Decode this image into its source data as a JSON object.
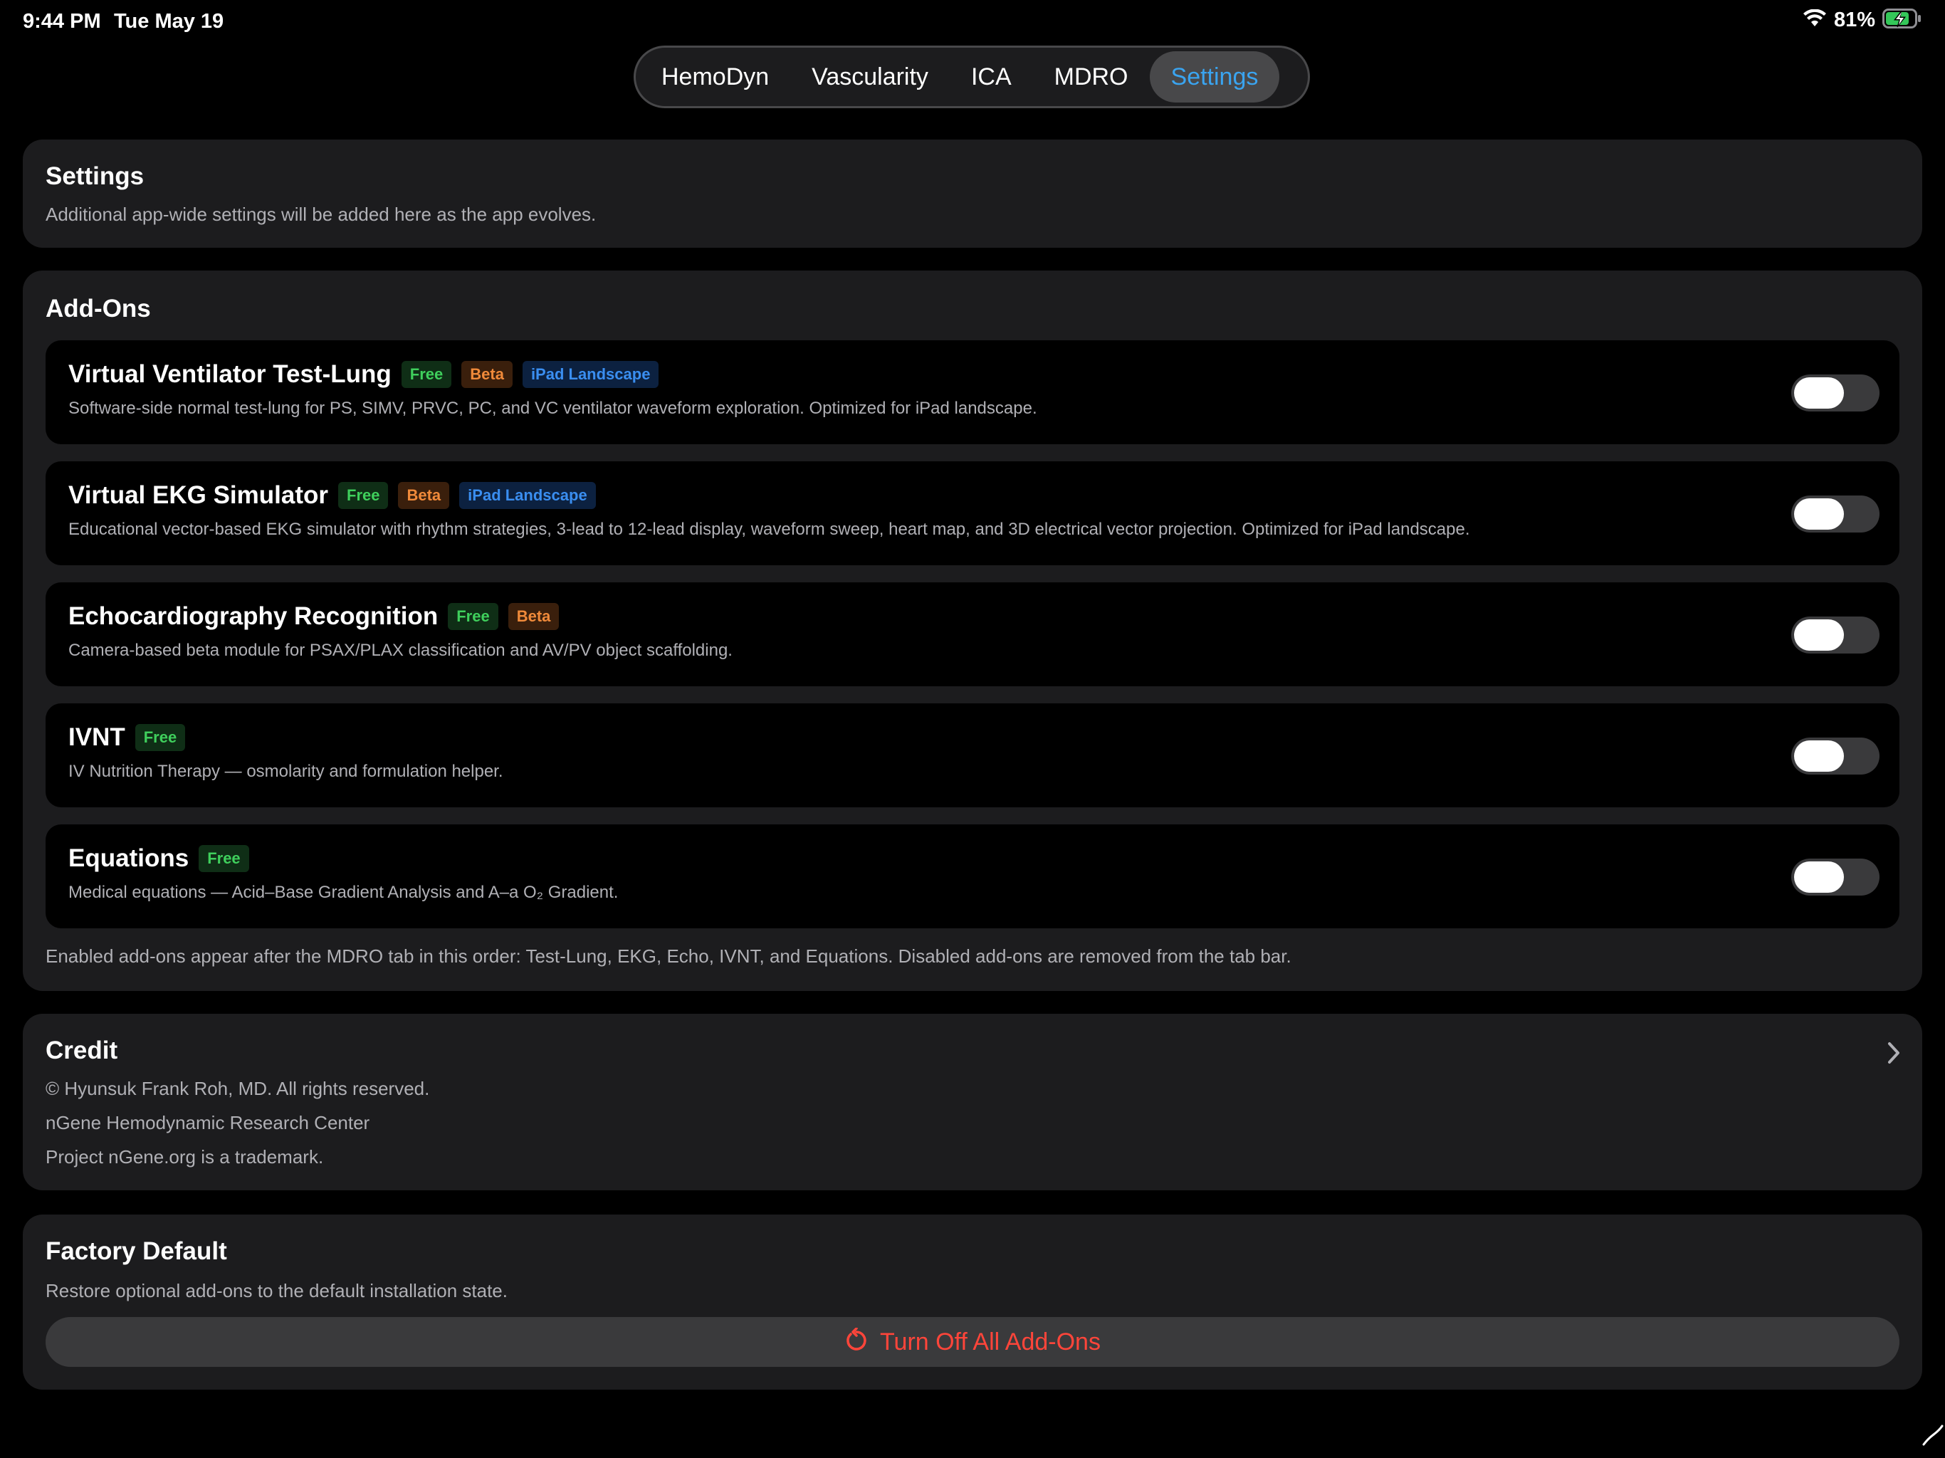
{
  "status_bar": {
    "time": "9:44 PM",
    "date": "Tue May 19",
    "battery": "81%"
  },
  "tabs": [
    {
      "label": "HemoDyn",
      "active": false
    },
    {
      "label": "Vascularity",
      "active": false
    },
    {
      "label": "ICA",
      "active": false
    },
    {
      "label": "MDRO",
      "active": false
    },
    {
      "label": "Settings",
      "active": true
    }
  ],
  "settings": {
    "title": "Settings",
    "subtitle": "Additional app-wide settings will be added here as the app evolves."
  },
  "addons": {
    "title": "Add-Ons",
    "items": [
      {
        "name": "Virtual Ventilator Test-Lung",
        "badges": [
          "Free",
          "Beta",
          "iPad Landscape"
        ],
        "description": "Software-side normal test-lung for PS, SIMV, PRVC, PC, and VC ventilator waveform exploration. Optimized for iPad landscape.",
        "enabled": false
      },
      {
        "name": "Virtual EKG Simulator",
        "badges": [
          "Free",
          "Beta",
          "iPad Landscape"
        ],
        "description": "Educational vector-based EKG simulator with rhythm strategies, 3-lead to 12-lead display, waveform sweep, heart map, and 3D electrical vector projection. Optimized for iPad landscape.",
        "enabled": false
      },
      {
        "name": "Echocardiography Recognition",
        "badges": [
          "Free",
          "Beta"
        ],
        "description": "Camera-based beta module for PSAX/PLAX classification and AV/PV object scaffolding.",
        "enabled": false
      },
      {
        "name": "IVNT",
        "badges": [
          "Free"
        ],
        "description": "IV Nutrition Therapy — osmolarity and formulation helper.",
        "enabled": false
      },
      {
        "name": "Equations",
        "badges": [
          "Free"
        ],
        "description": "Medical equations — Acid–Base Gradient Analysis and A–a O₂ Gradient.",
        "enabled": false
      }
    ],
    "footnote": "Enabled add-ons appear after the MDRO tab in this order: Test-Lung, EKG, Echo, IVNT, and Equations. Disabled add-ons are removed from the tab bar."
  },
  "credit": {
    "title": "Credit",
    "lines": [
      "© Hyunsuk Frank Roh, MD. All rights reserved.",
      "nGene Hemodynamic Research Center",
      "Project nGene.org is a trademark."
    ]
  },
  "factory_default": {
    "title": "Factory Default",
    "subtitle": "Restore optional add-ons to the default installation state.",
    "button_label": "Turn Off All Add-Ons"
  },
  "colors": {
    "accent": "#3aa4f0",
    "destructive": "#ff453a",
    "free": "#3fcf5c",
    "beta": "#f08a3a",
    "ipad": "#3a8ef0"
  }
}
